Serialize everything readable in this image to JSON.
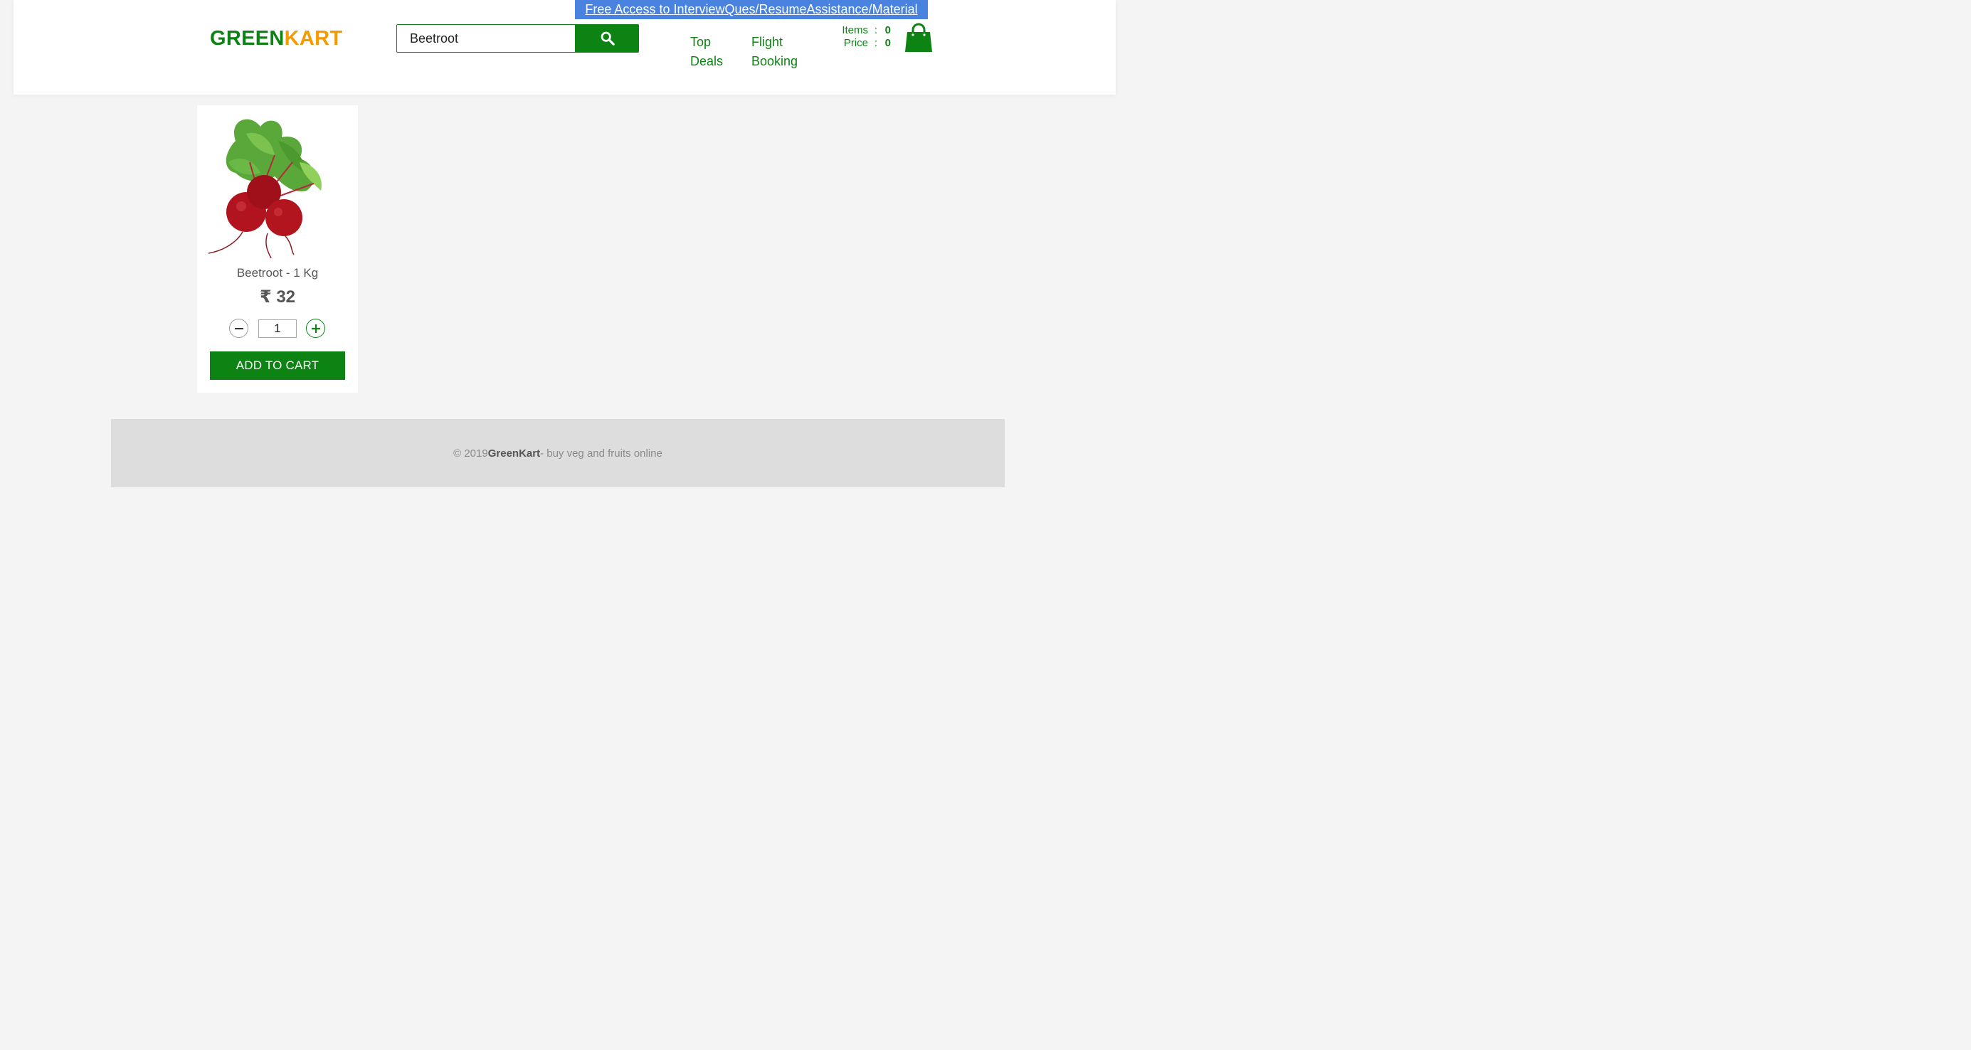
{
  "promo": {
    "text": "Free Access to InterviewQues/ResumeAssistance/Material"
  },
  "logo": {
    "part1": "GREEN",
    "part2": "KART"
  },
  "search": {
    "value": "Beetroot",
    "icon": "search-icon"
  },
  "nav": {
    "top_deals_line1": "Top",
    "top_deals_line2": "Deals",
    "flight_booking_line1": "Flight",
    "flight_booking_line2": "Booking"
  },
  "cart": {
    "items_label": "Items",
    "items_value": "0",
    "price_label": "Price",
    "price_value": "0",
    "separator": ":",
    "icon": "shopping-bag-icon"
  },
  "products": [
    {
      "name": "Beetroot - 1 Kg",
      "price": "₹ 32",
      "quantity": "1",
      "add_label": "ADD TO CART"
    }
  ],
  "footer": {
    "prefix": "© 2019 ",
    "brand": "GreenKart",
    "suffix": " - buy veg and fruits online"
  },
  "colors": {
    "brand_green": "#0d8313",
    "brand_orange": "#f59b00",
    "promo_blue": "#4a82e0",
    "footer_bg": "#dddddd",
    "page_bg": "#f4f4f4"
  }
}
